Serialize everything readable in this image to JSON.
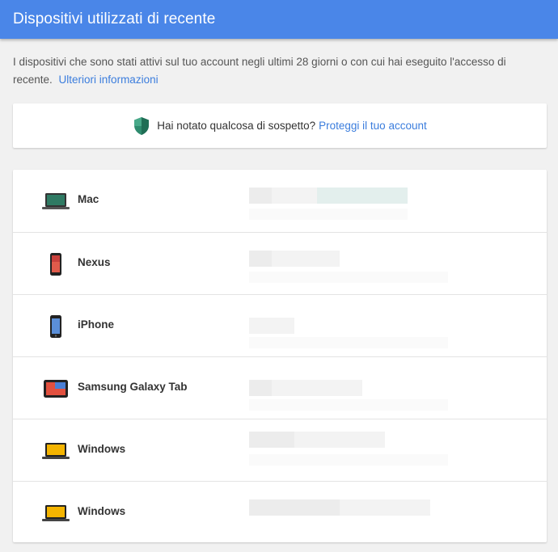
{
  "header": {
    "title": "Dispositivi utilizzati di recente"
  },
  "intro": {
    "text": "I dispositivi che sono stati attivi sul tuo account negli ultimi 28 giorni o con cui hai eseguito l'accesso di recente.",
    "link": "Ulteriori informazioni"
  },
  "alert": {
    "icon": "shield-icon",
    "text": "Hai notato qualcosa di sospetto?",
    "link": "Proteggi il tuo account"
  },
  "devices": [
    {
      "name": "Mac",
      "icon": "laptop-mac-icon"
    },
    {
      "name": "Nexus",
      "icon": "phone-nexus-icon"
    },
    {
      "name": "iPhone",
      "icon": "phone-iphone-icon"
    },
    {
      "name": "Samsung Galaxy Tab",
      "icon": "tablet-icon"
    },
    {
      "name": "Windows",
      "icon": "laptop-windows-icon"
    },
    {
      "name": "Windows",
      "icon": "laptop-windows-icon"
    }
  ],
  "colors": {
    "header": "#4a86e8",
    "link": "#3b7ddd",
    "shield": "#2e8b6e"
  }
}
